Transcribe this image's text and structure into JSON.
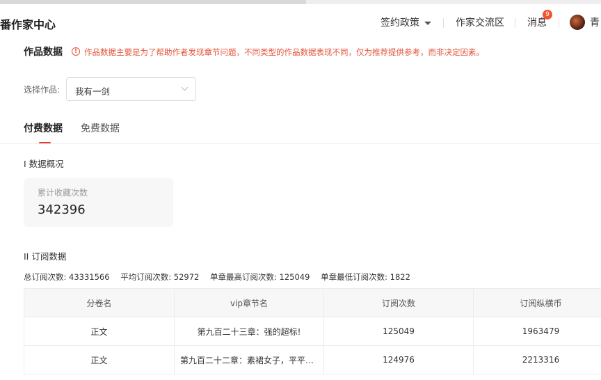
{
  "header": {
    "logo": "番作家中心",
    "nav": {
      "sign_policy": "签约政策",
      "community": "作家交流区",
      "messages": "消息",
      "message_count": "9",
      "user_name": "青"
    }
  },
  "page": {
    "title": "作品数据",
    "notice": "作品数据主要是为了帮助作者发现章节问题，不同类型的作品数据表现不同，仅为推荐提供参考，而非决定因素。",
    "select_label": "选择作品:",
    "selected_work": "我有一剑"
  },
  "tabs": [
    {
      "label": "付费数据",
      "active": true
    },
    {
      "label": "免费数据",
      "active": false
    }
  ],
  "overview": {
    "section_title": "I 数据概况",
    "stat_label": "累计收藏次数",
    "stat_value": "342396"
  },
  "subscription": {
    "section_title": "II 订阅数据",
    "summary": {
      "total": "总订阅次数: 43331566",
      "average": "平均订阅次数: 52972",
      "max": "单章最高订阅次数: 125049",
      "min": "单章最低订阅次数: 1822"
    },
    "columns": [
      "分卷名",
      "vip章节名",
      "订阅次数",
      "订阅纵横币"
    ],
    "rows": [
      [
        "正文",
        "第九百二十三章：强的超标!",
        "125049",
        "1963479"
      ],
      [
        "正文",
        "第九百二十二章：素裙女子，平平无奇",
        "124976",
        "2213316"
      ]
    ]
  },
  "colors": {
    "accent": "#e23b2b",
    "warning": "#e2533a",
    "badge": "#f2542d"
  }
}
